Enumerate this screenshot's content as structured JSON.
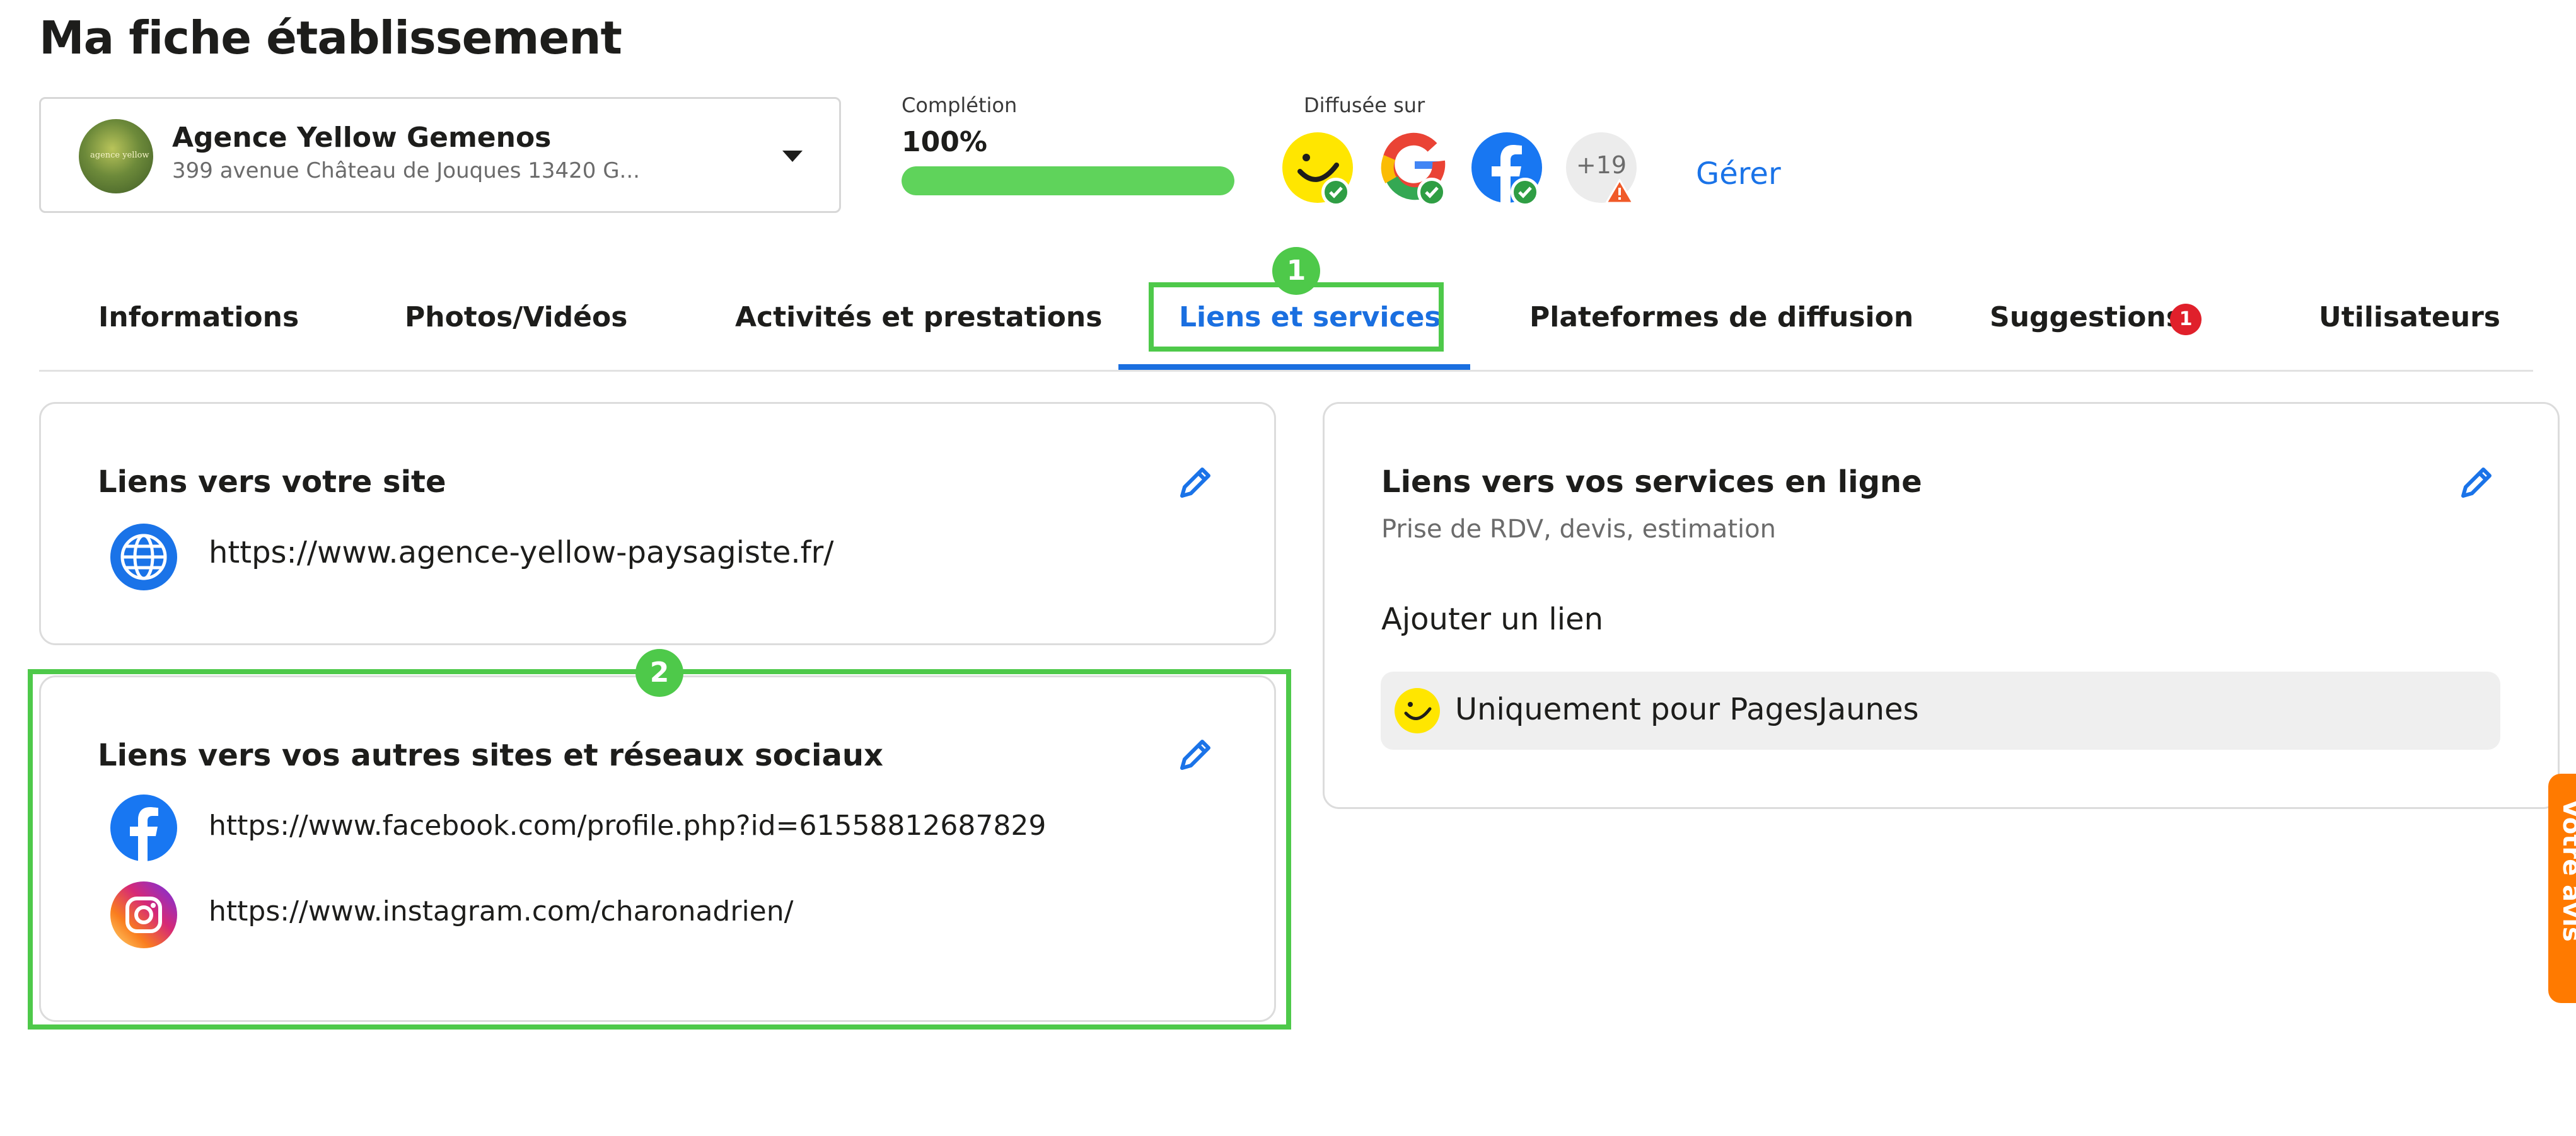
{
  "page": {
    "title": "Ma fiche établissement"
  },
  "establishment": {
    "name": "Agence Yellow Gemenos",
    "address": "399 avenue Château de Jouques 13420 G...",
    "avatar_text": "agence yellow"
  },
  "completion": {
    "label": "Complétion",
    "value": "100%",
    "fraction": 1.0
  },
  "diffusion": {
    "label": "Diffusée sur",
    "platforms": [
      "pagesjaunes-icon",
      "google-icon",
      "facebook-icon"
    ],
    "more_count": "+19",
    "manage_label": "Gérer"
  },
  "tabs": [
    {
      "label": "Informations"
    },
    {
      "label": "Photos/Vidéos"
    },
    {
      "label": "Activités et prestations"
    },
    {
      "label": "Liens et services",
      "active": true
    },
    {
      "label": "Plateformes de diffusion"
    },
    {
      "label": "Suggestions",
      "badge": "1"
    },
    {
      "label": "Utilisateurs"
    }
  ],
  "annotations": {
    "step1": "1",
    "step2": "2"
  },
  "site_links": {
    "title": "Liens vers votre site",
    "url": "https://www.agence-yellow-paysagiste.fr/"
  },
  "social_links": {
    "title": "Liens vers vos autres sites et réseaux sociaux",
    "facebook_url": "https://www.facebook.com/profile.php?id=61558812687829",
    "instagram_url": "https://www.instagram.com/charonadrien/"
  },
  "online_services": {
    "title": "Liens vers vos services en ligne",
    "subtitle": "Prise de RDV, devis, estimation",
    "add_link_label": "Ajouter un lien",
    "pj_only_label": "Uniquement pour PagesJaunes"
  },
  "side_tab": {
    "label": "Votre avis"
  },
  "colors": {
    "accent": "#1a73e8",
    "highlight": "#4ec94a",
    "progress": "#5fd35b",
    "pagesjaunes": "#ffe600",
    "facebook": "#1877f2",
    "badge": "#e0202b",
    "side_tab": "#ff7a00"
  }
}
